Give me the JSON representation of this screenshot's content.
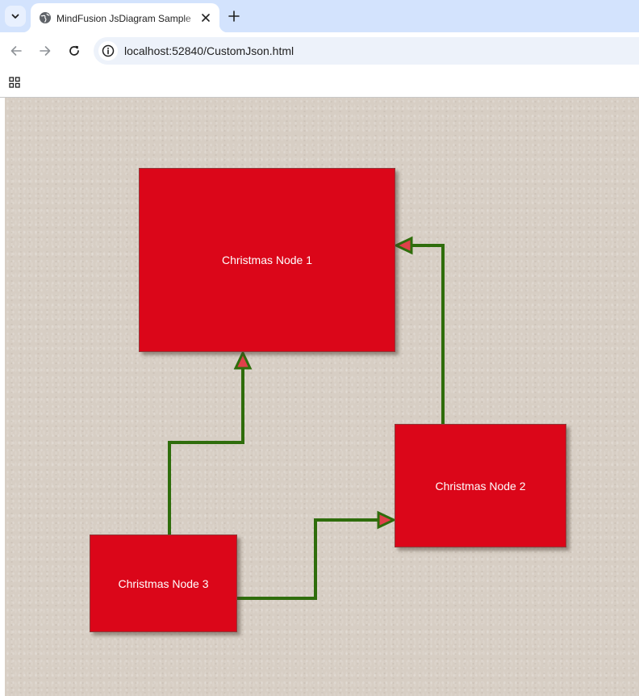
{
  "browser": {
    "tab": {
      "title": "MindFusion JsDiagram Sample"
    },
    "omnibox": {
      "url": "localhost:52840/CustomJson.html"
    }
  },
  "colors": {
    "tab_strip": "#d3e3fd",
    "canvas_background": "#d7cec4",
    "node_fill": "#db0619",
    "node_text": "#ffffff",
    "link_stroke": "#2f6d0c",
    "arrowhead_fill": "#e0404a"
  },
  "icons": {
    "tab_list": "chevron-down-icon",
    "favicon": "globe-icon",
    "tab_close": "close-icon",
    "new_tab": "plus-icon",
    "back": "arrow-left-icon",
    "forward": "arrow-right-icon",
    "reload": "reload-icon",
    "site_info": "info-icon",
    "apps": "apps-grid-icon"
  },
  "diagram": {
    "nodes": [
      {
        "id": "node1",
        "label": "Christmas Node 1"
      },
      {
        "id": "node2",
        "label": "Christmas Node 2"
      },
      {
        "id": "node3",
        "label": "Christmas Node 3"
      }
    ],
    "links": [
      {
        "from": "node3",
        "to": "node1"
      },
      {
        "from": "node3",
        "to": "node2"
      },
      {
        "from": "node2",
        "to": "node1"
      }
    ]
  }
}
